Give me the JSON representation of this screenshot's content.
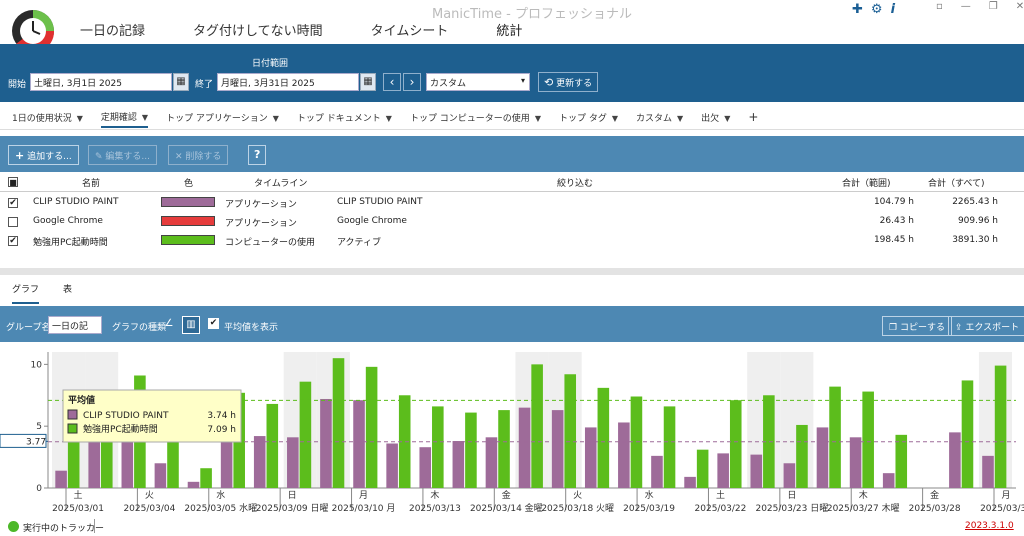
{
  "app": {
    "title": "ManicTime - プロフェッショナル",
    "version": "2023.3.1.0"
  },
  "tabs": [
    "一日の記録",
    "タグ付けしてない時間",
    "タイムシート",
    "統計"
  ],
  "daterange": {
    "section_label": "日付範囲",
    "start_label": "開始",
    "start_value": "土曜日, 3月1日 2025",
    "end_label": "終了",
    "end_value": "月曜日, 3月31日 2025",
    "range_select": "カスタム",
    "update_button": "更新する"
  },
  "subtabs": [
    "1日の使用状況",
    "定期確認",
    "トップ アプリケーション",
    "トップ ドキュメント",
    "トップ コンピューターの使用",
    "トップ タグ",
    "カスタム",
    "出欠"
  ],
  "toolbar": {
    "add": "追加する...",
    "edit": "編集する...",
    "delete": "削除する",
    "help": "?"
  },
  "table": {
    "headers": {
      "name": "名前",
      "color": "色",
      "timeline": "タイムライン",
      "filter": "絞り込む",
      "total_range": "合計（範囲)",
      "total_all": "合計（すべて)"
    },
    "rows": [
      {
        "checked": true,
        "check_mark": "✔",
        "name": "CLIP STUDIO PAINT",
        "color": "#9e6b99",
        "timeline": "アプリケーション",
        "filter": "CLIP STUDIO PAINT",
        "total_range": "104.79 h",
        "total_all": "2265.43 h"
      },
      {
        "checked": false,
        "check_mark": "",
        "name": "Google Chrome",
        "color": "#e63c3c",
        "timeline": "アプリケーション",
        "filter": "Google Chrome",
        "total_range": "26.43 h",
        "total_all": "909.96 h"
      },
      {
        "checked": true,
        "check_mark": "✔",
        "name": "勉強用PC起動時間",
        "color": "#5cbd1c",
        "timeline": "コンピューターの使用",
        "filter": "アクティブ",
        "total_range": "198.45 h",
        "total_all": "3891.30 h"
      }
    ]
  },
  "bottom_tabs": [
    "グラフ",
    "表"
  ],
  "graph_toolbar": {
    "group_label": "グループ名",
    "group_value": "一日の記",
    "type_label": "グラフの種類",
    "avg_label": "平均値を表示",
    "copy": "コピーする",
    "export": "エクスポート"
  },
  "status": {
    "tracker": "実行中のトラッカー"
  },
  "chart_data": {
    "type": "bar",
    "series": [
      {
        "name": "CLIP STUDIO PAINT",
        "color": "#9e6b99",
        "values": [
          1.4,
          3.8,
          4.0,
          2.0,
          0.5,
          4.3,
          4.2,
          4.1,
          7.2,
          7.1,
          3.6,
          3.3,
          3.8,
          4.1,
          6.5,
          6.3,
          4.9,
          5.3,
          2.6,
          0.9,
          2.8,
          2.7,
          2.0,
          4.9,
          4.1,
          1.2,
          0,
          4.5,
          2.6
        ]
      },
      {
        "name": "勉強用PC起動時間",
        "color": "#5cbd1c",
        "values": [
          4.0,
          7.4,
          9.1,
          5.5,
          1.6,
          7.7,
          6.8,
          8.6,
          10.5,
          9.8,
          7.5,
          6.6,
          6.1,
          6.3,
          10.0,
          9.2,
          8.1,
          7.4,
          6.6,
          3.1,
          7.1,
          7.5,
          5.1,
          8.2,
          7.8,
          4.3,
          0,
          8.7,
          9.9
        ]
      }
    ],
    "yticks": [
      0,
      5,
      10
    ],
    "ylim": [
      0,
      11
    ],
    "averages": {
      "CLIP STUDIO PAINT": 3.74,
      "勉強用PC起動時間": 7.09
    },
    "avg_axis_label": "3.77",
    "tooltip": {
      "title": "平均値",
      "rows": [
        {
          "name": "CLIP STUDIO PAINT",
          "value": "3.74 h"
        },
        {
          "name": "勉強用PC起動時間",
          "value": "7.09 h"
        }
      ]
    },
    "day_labels": [
      "土",
      "火",
      "水",
      "日",
      "月",
      "木",
      "金",
      "火",
      "水",
      "土",
      "日",
      "木",
      "金",
      "月"
    ],
    "date_labels": [
      "2025/03/01",
      "2025/03/04",
      "2025/03/05 水曜",
      "2025/03/09 日曜",
      "2025/03/10 月",
      "2025/03/13",
      "2025/03/14 金曜",
      "2025/03/18 火曜",
      "2025/03/19",
      "2025/03/22",
      "2025/03/23 日曜",
      "2025/03/27 木曜",
      "2025/03/28",
      "2025/03/31"
    ]
  }
}
